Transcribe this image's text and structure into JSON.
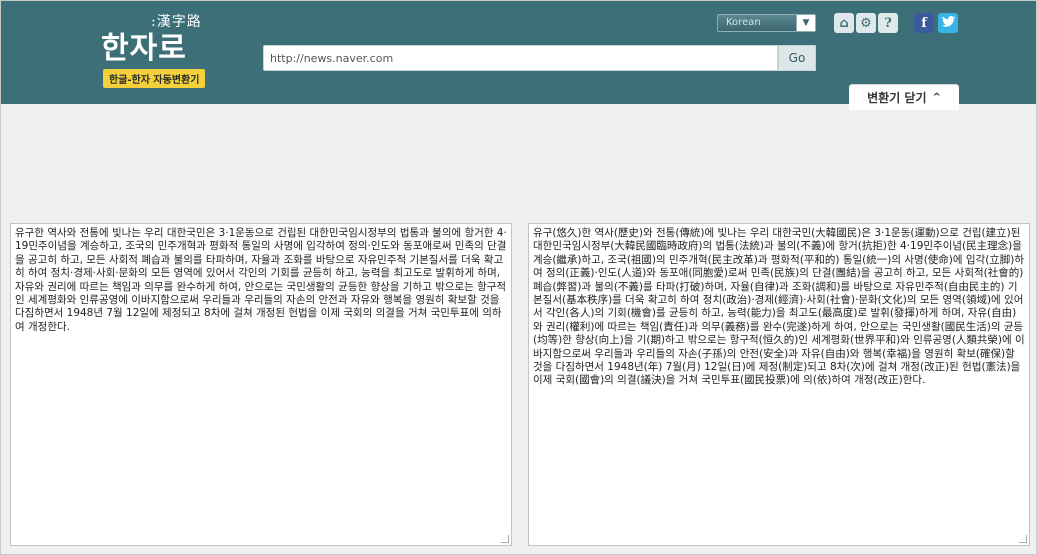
{
  "logo": {
    "sub": ":漢字路",
    "main": "한자로",
    "tagline": "한글-한자 자동변환기"
  },
  "language": {
    "selected": "Korean"
  },
  "toolbar_icons": [
    "home-icon",
    "gear-icon",
    "help-icon",
    "facebook-icon",
    "twitter-icon"
  ],
  "url": {
    "value": "http://news.naver.com",
    "go_label": "Go"
  },
  "converter_tab": {
    "label": "변환기 닫기",
    "chevron": "^"
  },
  "colors": {
    "header_bg": "#3d6f78",
    "tag_bg": "#f4d13a",
    "facebook": "#3b5b9a",
    "twitter": "#37b4e8"
  },
  "input_text": "유구한 역사와 전통에 빛나는 우리 대한국민은 3·1운동으로 건립된 대한민국임시정부의 법통과 불의에 항거한 4·19민주이념을 계승하고, 조국의 민주개혁과 평화적 통일의 사명에 입각하여 정의·인도와 동포애로써 민족의 단결을 공고히 하고, 모든 사회적 폐습과 불의를 타파하며, 자율과 조화를 바탕으로 자유민주적 기본질서를 더욱 확고히 하여 정치·경제·사회·문화의 모든 영역에 있어서 각인의 기회를 균등히 하고, 능력을 최고도로 발휘하게 하며, 자유와 권리에 따르는 책임과 의무를 완수하게 하여, 안으로는 국민생활의 균등한 향상을 기하고 밖으로는 항구적인 세계평화와 인류공영에 이바지함으로써 우리들과 우리들의 자손의 안전과 자유와 행복을 영원히 확보할 것을 다짐하면서 1948년 7월 12일에 제정되고 8차에 걸쳐 개정된 헌법을 이제 국회의 의결을 거쳐 국민투표에 의하여 개정한다.",
  "output_text": "유구(悠久)한 역사(歷史)와 전통(傳統)에 빛나는 우리 대한국민(大韓國民)은 3·1운동(運動)으로 건립(建立)된 대한민국임시정부(大韓民國臨時政府)의 법통(法統)과 불의(不義)에 항거(抗拒)한 4·19민주이념(民主理念)을 계승(繼承)하고, 조국(祖國)의 민주개혁(民主改革)과 평화적(平和的) 통일(統一)의 사명(使命)에 입각(立脚)하여 정의(正義)·인도(人道)와 동포애(同胞愛)로써 민족(民族)의 단결(團結)을 공고히 하고, 모든 사회적(社會的) 폐습(弊習)과 불의(不義)를 타파(打破)하며, 자율(自律)과 조화(調和)를 바탕으로 자유민주적(自由民主的) 기본질서(基本秩序)를 더욱 확고히 하여 정치(政治)·경제(經濟)·사회(社會)·문화(文化)의 모든 영역(領域)에 있어서 각인(各人)의 기회(機會)를 균등히 하고, 능력(能力)을 최고도(最高度)로 발휘(發揮)하게 하며, 자유(自由)와 권리(權利)에 따르는 책임(責任)과 의무(義務)를 완수(完遂)하게 하여, 안으로는 국민생활(國民生活)의 균등(均等)한 향상(向上)을 기(期)하고 밖으로는 항구적(恒久的)인 세계평화(世界平和)와 인류공영(人類共榮)에 이바지함으로써 우리들과 우리들의 자손(子孫)의 안전(安全)과 자유(自由)와 행복(幸福)을 영원히 확보(確保)할 것을 다짐하면서 1948년(年) 7월(月) 12일(日)에 제정(制定)되고 8차(次)에 걸쳐 개정(改正)된 헌법(憲法)을 이제 국회(國會)의 의결(議決)을 거쳐 국민투표(國民投票)에 의(依)하여 개정(改正)한다."
}
